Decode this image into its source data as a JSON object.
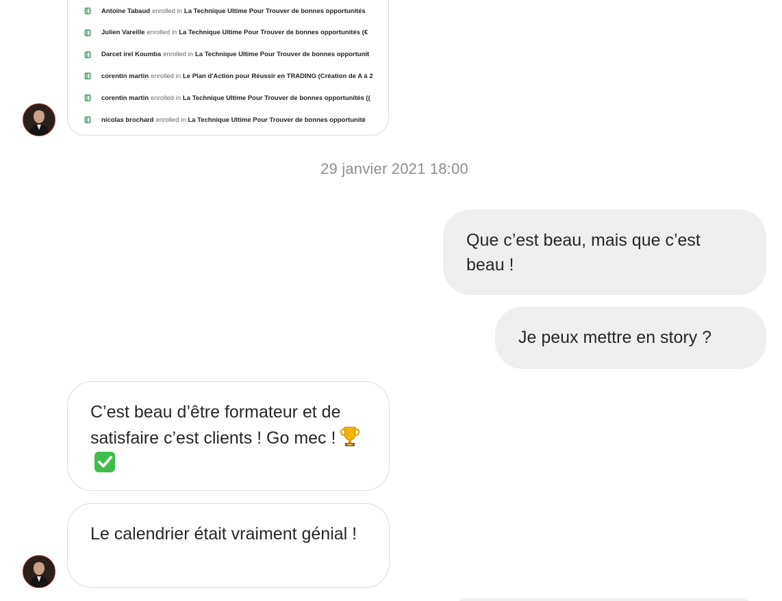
{
  "shared_card": {
    "enrollments": [
      {
        "name": "Antoine Tabaud",
        "verb": "enrolled in",
        "course": "La Technique Ultime Pour Trouver de bonnes opportunités"
      },
      {
        "name": "Julien Vareille",
        "verb": "enrolled in",
        "course": "La Technique Ultime Pour Trouver de bonnes opportunités (€"
      },
      {
        "name": "Darcet irel Koumba",
        "verb": "enrolled in",
        "course": "La Technique Ultime Pour Trouver de bonnes opportunit"
      },
      {
        "name": "corentin martin",
        "verb": "enrolled in",
        "course": "Le Plan d'Action pour Réussir en TRADING (Création de A à 2"
      },
      {
        "name": "corentin martin",
        "verb": "enrolled in",
        "course": "La Technique Ultime Pour Trouver de bonnes opportunités (("
      },
      {
        "name": "nicolas brochard",
        "verb": "enrolled in",
        "course": "La Technique Ultime Pour Trouver de bonnes opportunité"
      }
    ],
    "icon": "book-icon"
  },
  "timestamp": "29 janvier 2021 18:00",
  "messages": {
    "sent_1": "Que c’est beau, mais que c’est beau !",
    "sent_2": "Je peux mettre en story ?",
    "received_1": "C’est beau d’être formateur et de satisfaire c’est clients ! Go mec !",
    "received_1_emojis": [
      "trophy-emoji",
      "check-mark-button-emoji"
    ],
    "received_2": "Le calendrier était vraiment génial !"
  },
  "colors": {
    "sent_bubble": "#efefef",
    "received_border": "#dbdbdb",
    "timestamp": "#8e8e8e",
    "text": "#262626"
  }
}
